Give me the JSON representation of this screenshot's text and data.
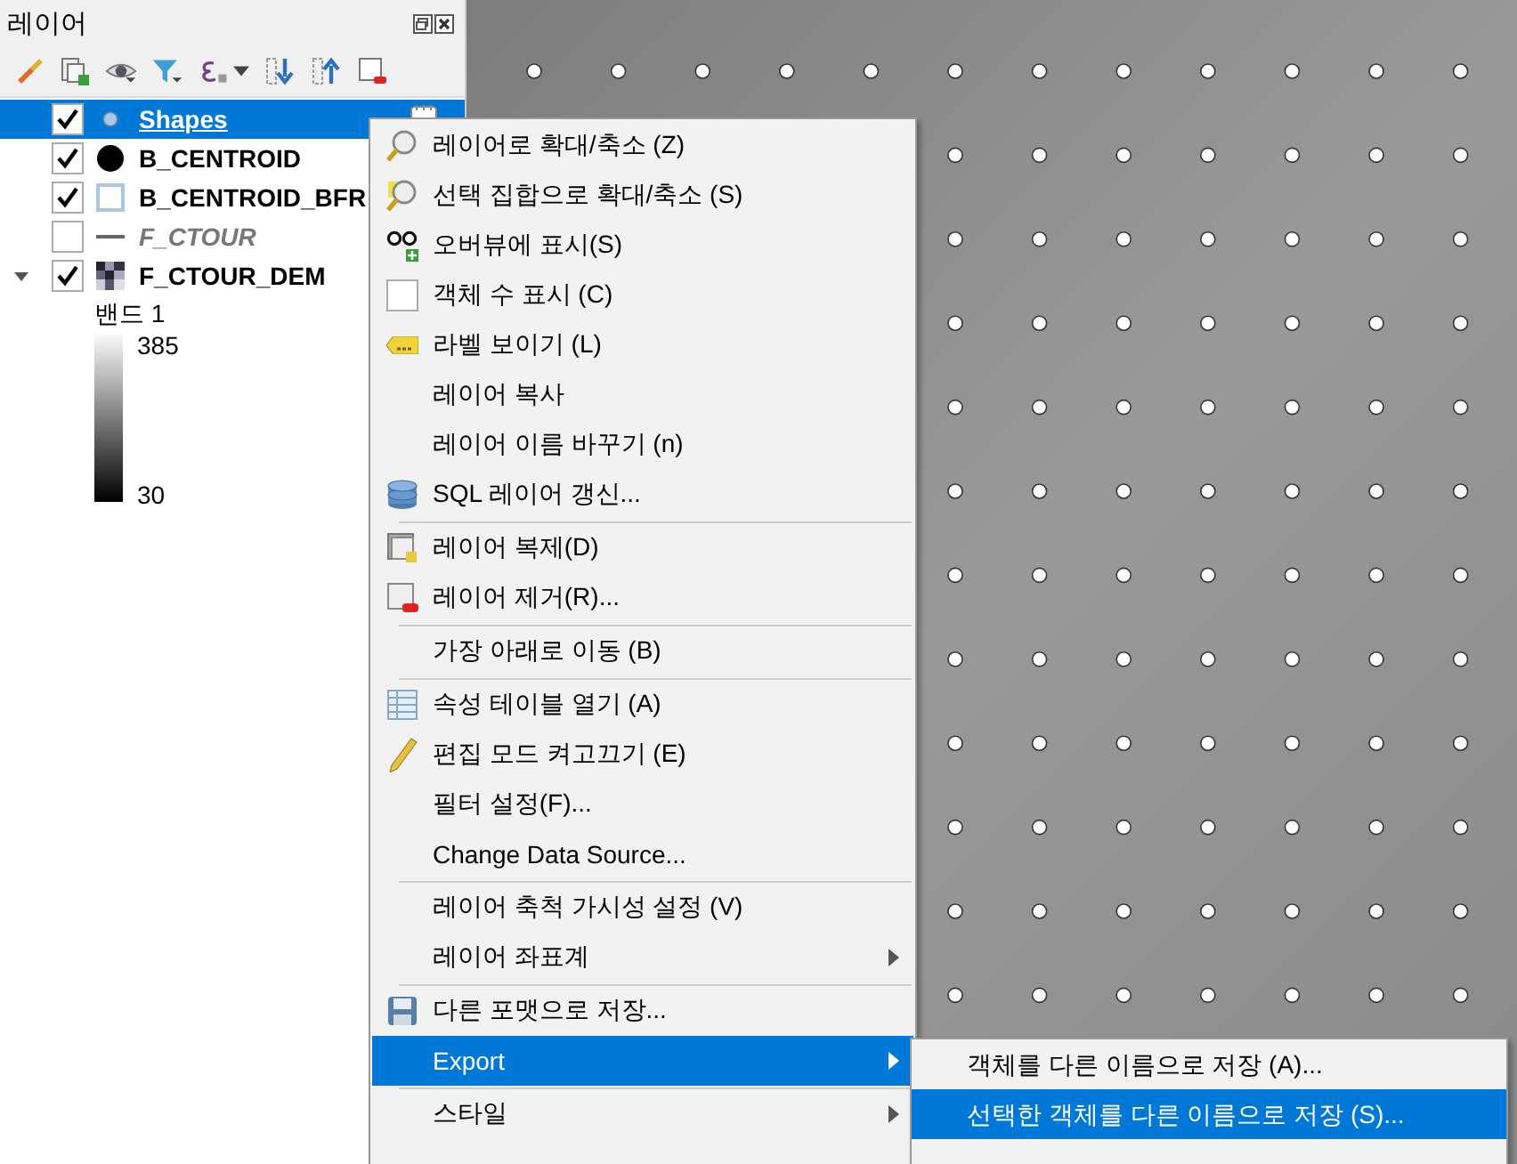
{
  "panel": {
    "title": "레이어",
    "layers": [
      {
        "name": "Shapes",
        "checked": true,
        "selected": true,
        "kind": "point"
      },
      {
        "name": "B_CENTROID",
        "checked": true,
        "selected": false,
        "kind": "dot"
      },
      {
        "name": "B_CENTROID_BFR",
        "checked": true,
        "selected": false,
        "kind": "square"
      },
      {
        "name": "F_CTOUR",
        "checked": false,
        "selected": false,
        "kind": "line"
      },
      {
        "name": "F_CTOUR_DEM",
        "checked": true,
        "selected": false,
        "kind": "raster",
        "expanded": true,
        "legend": {
          "band": "밴드 1",
          "max": "385",
          "min": "30"
        }
      }
    ]
  },
  "context_menu": {
    "sections": [
      [
        {
          "label": "레이어로 확대/축소 (Z)",
          "kind": "zoom",
          "selected": false
        },
        {
          "label": "선택 집합으로 확대/축소 (S)",
          "kind": "zoom-select",
          "selected": false
        },
        {
          "label": "오버뷰에 표시(S)",
          "kind": "overview",
          "selected": false
        },
        {
          "label": "객체 수 표시 (C)",
          "kind": "checkbox",
          "selected": false
        },
        {
          "label": "라벨 보이기 (L)",
          "kind": "label",
          "selected": false
        },
        {
          "label": "레이어 복사",
          "kind": "none",
          "selected": false
        },
        {
          "label": "레이어 이름 바꾸기 (n)",
          "kind": "none",
          "selected": false
        },
        {
          "label": "SQL 레이어 갱신...",
          "kind": "database",
          "selected": false
        }
      ],
      [
        {
          "label": "레이어 복제(D)",
          "kind": "duplicate",
          "selected": false
        },
        {
          "label": "레이어 제거(R)...",
          "kind": "remove",
          "selected": false
        }
      ],
      [
        {
          "label": "가장 아래로 이동 (B)",
          "kind": "none",
          "selected": false
        }
      ],
      [
        {
          "label": "속성 테이블 열기 (A)",
          "kind": "table",
          "selected": false
        },
        {
          "label": "편집 모드 켜고끄기 (E)",
          "kind": "pencil",
          "selected": false
        },
        {
          "label": "필터 설정(F)...",
          "kind": "none",
          "selected": false
        },
        {
          "label": "Change Data Source...",
          "kind": "none",
          "selected": false
        }
      ],
      [
        {
          "label": "레이어 축척 가시성 설정 (V)",
          "kind": "none",
          "selected": false
        },
        {
          "label": "레이어 좌표계",
          "kind": "none",
          "selected": false,
          "submenu": true
        }
      ],
      [
        {
          "label": "다른 포맷으로 저장...",
          "kind": "save",
          "selected": false
        },
        {
          "label": "Export",
          "kind": "none",
          "selected": true,
          "submenu": true
        }
      ],
      [
        {
          "label": "스타일",
          "kind": "none",
          "selected": false,
          "submenu": true
        }
      ]
    ]
  },
  "submenu": {
    "items": [
      {
        "label": "객체를 다른 이름으로 저장 (A)...",
        "selected": false
      },
      {
        "label": "선택한 객체를 다른 이름으로 저장 (S)...",
        "selected": true
      }
    ]
  }
}
